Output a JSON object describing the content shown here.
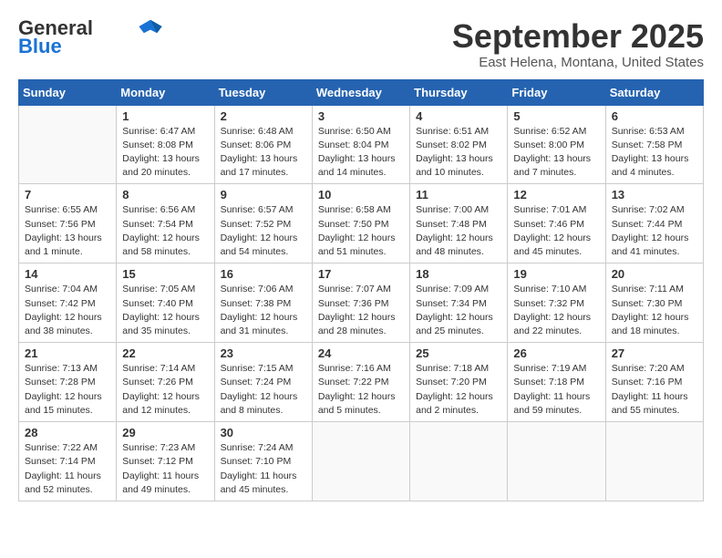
{
  "header": {
    "logo_line1": "General",
    "logo_line2": "Blue",
    "title": "September 2025",
    "subtitle": "East Helena, Montana, United States"
  },
  "days_of_week": [
    "Sunday",
    "Monday",
    "Tuesday",
    "Wednesday",
    "Thursday",
    "Friday",
    "Saturday"
  ],
  "weeks": [
    [
      {
        "day": "",
        "content": ""
      },
      {
        "day": "1",
        "content": "Sunrise: 6:47 AM\nSunset: 8:08 PM\nDaylight: 13 hours\nand 20 minutes."
      },
      {
        "day": "2",
        "content": "Sunrise: 6:48 AM\nSunset: 8:06 PM\nDaylight: 13 hours\nand 17 minutes."
      },
      {
        "day": "3",
        "content": "Sunrise: 6:50 AM\nSunset: 8:04 PM\nDaylight: 13 hours\nand 14 minutes."
      },
      {
        "day": "4",
        "content": "Sunrise: 6:51 AM\nSunset: 8:02 PM\nDaylight: 13 hours\nand 10 minutes."
      },
      {
        "day": "5",
        "content": "Sunrise: 6:52 AM\nSunset: 8:00 PM\nDaylight: 13 hours\nand 7 minutes."
      },
      {
        "day": "6",
        "content": "Sunrise: 6:53 AM\nSunset: 7:58 PM\nDaylight: 13 hours\nand 4 minutes."
      }
    ],
    [
      {
        "day": "7",
        "content": "Sunrise: 6:55 AM\nSunset: 7:56 PM\nDaylight: 13 hours\nand 1 minute."
      },
      {
        "day": "8",
        "content": "Sunrise: 6:56 AM\nSunset: 7:54 PM\nDaylight: 12 hours\nand 58 minutes."
      },
      {
        "day": "9",
        "content": "Sunrise: 6:57 AM\nSunset: 7:52 PM\nDaylight: 12 hours\nand 54 minutes."
      },
      {
        "day": "10",
        "content": "Sunrise: 6:58 AM\nSunset: 7:50 PM\nDaylight: 12 hours\nand 51 minutes."
      },
      {
        "day": "11",
        "content": "Sunrise: 7:00 AM\nSunset: 7:48 PM\nDaylight: 12 hours\nand 48 minutes."
      },
      {
        "day": "12",
        "content": "Sunrise: 7:01 AM\nSunset: 7:46 PM\nDaylight: 12 hours\nand 45 minutes."
      },
      {
        "day": "13",
        "content": "Sunrise: 7:02 AM\nSunset: 7:44 PM\nDaylight: 12 hours\nand 41 minutes."
      }
    ],
    [
      {
        "day": "14",
        "content": "Sunrise: 7:04 AM\nSunset: 7:42 PM\nDaylight: 12 hours\nand 38 minutes."
      },
      {
        "day": "15",
        "content": "Sunrise: 7:05 AM\nSunset: 7:40 PM\nDaylight: 12 hours\nand 35 minutes."
      },
      {
        "day": "16",
        "content": "Sunrise: 7:06 AM\nSunset: 7:38 PM\nDaylight: 12 hours\nand 31 minutes."
      },
      {
        "day": "17",
        "content": "Sunrise: 7:07 AM\nSunset: 7:36 PM\nDaylight: 12 hours\nand 28 minutes."
      },
      {
        "day": "18",
        "content": "Sunrise: 7:09 AM\nSunset: 7:34 PM\nDaylight: 12 hours\nand 25 minutes."
      },
      {
        "day": "19",
        "content": "Sunrise: 7:10 AM\nSunset: 7:32 PM\nDaylight: 12 hours\nand 22 minutes."
      },
      {
        "day": "20",
        "content": "Sunrise: 7:11 AM\nSunset: 7:30 PM\nDaylight: 12 hours\nand 18 minutes."
      }
    ],
    [
      {
        "day": "21",
        "content": "Sunrise: 7:13 AM\nSunset: 7:28 PM\nDaylight: 12 hours\nand 15 minutes."
      },
      {
        "day": "22",
        "content": "Sunrise: 7:14 AM\nSunset: 7:26 PM\nDaylight: 12 hours\nand 12 minutes."
      },
      {
        "day": "23",
        "content": "Sunrise: 7:15 AM\nSunset: 7:24 PM\nDaylight: 12 hours\nand 8 minutes."
      },
      {
        "day": "24",
        "content": "Sunrise: 7:16 AM\nSunset: 7:22 PM\nDaylight: 12 hours\nand 5 minutes."
      },
      {
        "day": "25",
        "content": "Sunrise: 7:18 AM\nSunset: 7:20 PM\nDaylight: 12 hours\nand 2 minutes."
      },
      {
        "day": "26",
        "content": "Sunrise: 7:19 AM\nSunset: 7:18 PM\nDaylight: 11 hours\nand 59 minutes."
      },
      {
        "day": "27",
        "content": "Sunrise: 7:20 AM\nSunset: 7:16 PM\nDaylight: 11 hours\nand 55 minutes."
      }
    ],
    [
      {
        "day": "28",
        "content": "Sunrise: 7:22 AM\nSunset: 7:14 PM\nDaylight: 11 hours\nand 52 minutes."
      },
      {
        "day": "29",
        "content": "Sunrise: 7:23 AM\nSunset: 7:12 PM\nDaylight: 11 hours\nand 49 minutes."
      },
      {
        "day": "30",
        "content": "Sunrise: 7:24 AM\nSunset: 7:10 PM\nDaylight: 11 hours\nand 45 minutes."
      },
      {
        "day": "",
        "content": ""
      },
      {
        "day": "",
        "content": ""
      },
      {
        "day": "",
        "content": ""
      },
      {
        "day": "",
        "content": ""
      }
    ]
  ]
}
